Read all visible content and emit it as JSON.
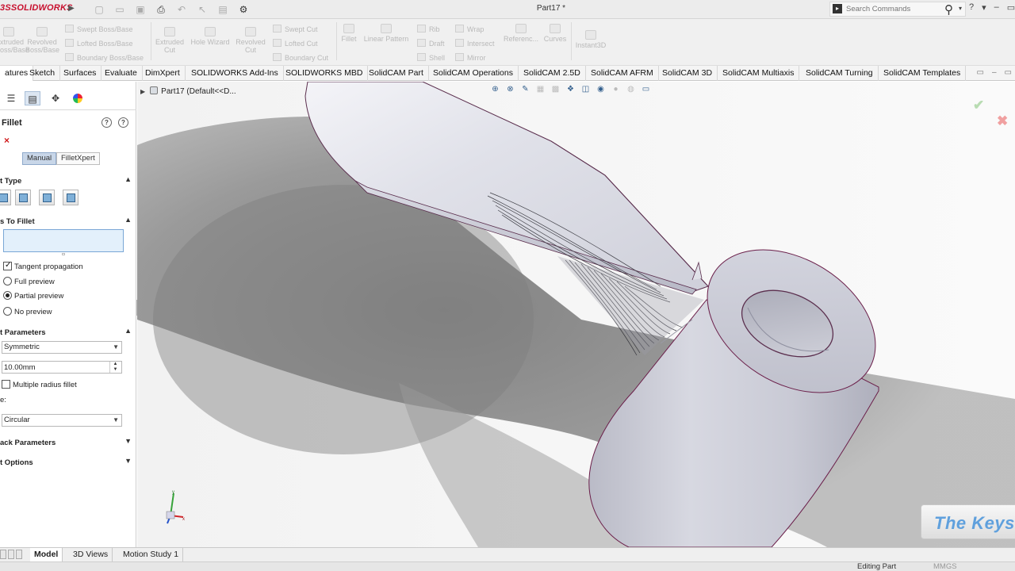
{
  "app": {
    "logo_prefix": "3S",
    "logo_name": "SOLIDWORKS",
    "document_title": "Part17 *"
  },
  "search": {
    "placeholder": "Search Commands"
  },
  "ribbon": {
    "extruded_base": "Extruded\nBoss/Base",
    "revolved_base": "Revolved\nBoss/Base",
    "swept_boss": "Swept Boss/Base",
    "lofted_boss": "Lofted Boss/Base",
    "boundary_boss": "Boundary Boss/Base",
    "extruded_cut": "Extruded\nCut",
    "hole_wizard": "Hole Wizard",
    "revolved_cut": "Revolved\nCut",
    "swept_cut": "Swept Cut",
    "lofted_cut": "Lofted Cut",
    "boundary_cut": "Boundary Cut",
    "fillet": "Fillet",
    "linear_pattern": "Linear Pattern",
    "rib": "Rib",
    "draft": "Draft",
    "shell": "Shell",
    "wrap": "Wrap",
    "intersect": "Intersect",
    "mirror": "Mirror",
    "reference": "Referenc...",
    "curves": "Curves",
    "instant3d": "Instant3D"
  },
  "command_tabs": [
    "atures",
    "Sketch",
    "Surfaces",
    "Evaluate",
    "DimXpert",
    "SOLIDWORKS Add-Ins",
    "SOLIDWORKS MBD",
    "SolidCAM Part",
    "SolidCAM Operations",
    "SolidCAM 2.5D",
    "SolidCAM AFRM",
    "SolidCAM 3D",
    "SolidCAM Multiaxis",
    "SolidCAM Turning",
    "SolidCAM Templates"
  ],
  "property_manager": {
    "title": "Fillet",
    "mode_manual": "Manual",
    "mode_filletxpert": "FilletXpert",
    "section_type": "t Type",
    "section_items": "s To Fillet",
    "tangent_propagation": "Tangent propagation",
    "tangent_checked": true,
    "full_preview": "Full preview",
    "partial_preview": "Partial preview",
    "no_preview": "No preview",
    "selected_preview": "partial",
    "section_params": "t Parameters",
    "symmetric": "Symmetric",
    "radius_value": "10.00mm",
    "multiple_radius": "Multiple radius fillet",
    "profile_label": "e:",
    "profile_value": "Circular",
    "section_setback": "ack Parameters",
    "section_options": "t Options"
  },
  "viewport": {
    "tree_label": "Part17  (Default<<D..."
  },
  "bottom_tabs": [
    "Model",
    "3D Views",
    "Motion Study 1"
  ],
  "status": {
    "editing": "Editing Part",
    "units": "MMGS"
  },
  "watermark": "The Keys",
  "colors": {
    "accent_red": "#c8102e",
    "selection_fill": "#e3f0fb",
    "selection_border": "#7aa7d6",
    "model_face": "#c9cad6",
    "model_edge": "#6b1f4a"
  }
}
